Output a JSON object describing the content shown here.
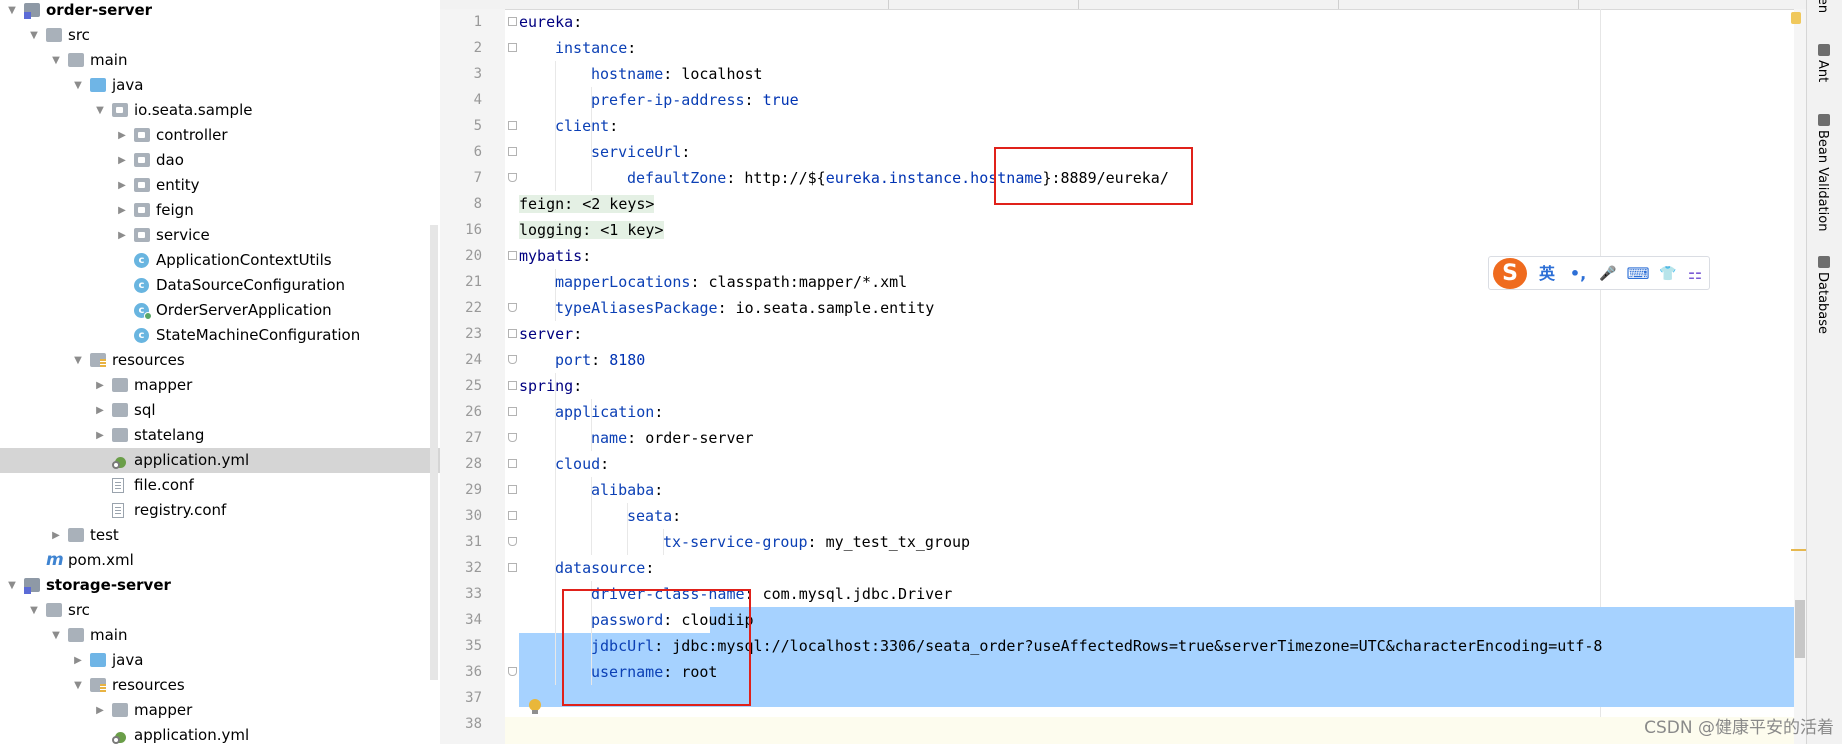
{
  "project_tree": {
    "items": [
      {
        "label": "order-server",
        "bold": true,
        "icon": "module-folder-icon",
        "expanded": true
      },
      {
        "label": "src",
        "icon": "folder-icon",
        "expanded": true
      },
      {
        "label": "main",
        "icon": "folder-icon",
        "expanded": true
      },
      {
        "label": "java",
        "icon": "source-root-folder-icon",
        "expanded": true
      },
      {
        "label": "io.seata.sample",
        "icon": "package-icon",
        "expanded": true
      },
      {
        "label": "controller",
        "icon": "package-icon",
        "expanded": false
      },
      {
        "label": "dao",
        "icon": "package-icon",
        "expanded": false
      },
      {
        "label": "entity",
        "icon": "package-icon",
        "expanded": false
      },
      {
        "label": "feign",
        "icon": "package-icon",
        "expanded": false
      },
      {
        "label": "service",
        "icon": "package-icon",
        "expanded": false
      },
      {
        "label": "ApplicationContextUtils",
        "icon": "java-class-icon"
      },
      {
        "label": "DataSourceConfiguration",
        "icon": "java-class-icon"
      },
      {
        "label": "OrderServerApplication",
        "icon": "spring-boot-class-icon"
      },
      {
        "label": "StateMachineConfiguration",
        "icon": "java-class-icon"
      },
      {
        "label": "resources",
        "icon": "resources-folder-icon",
        "expanded": true
      },
      {
        "label": "mapper",
        "icon": "folder-icon",
        "expanded": false
      },
      {
        "label": "sql",
        "icon": "folder-icon",
        "expanded": false
      },
      {
        "label": "statelang",
        "icon": "folder-icon",
        "expanded": false
      },
      {
        "label": "application.yml",
        "icon": "yaml-file-icon",
        "selected": true
      },
      {
        "label": "file.conf",
        "icon": "text-file-icon"
      },
      {
        "label": "registry.conf",
        "icon": "text-file-icon"
      },
      {
        "label": "test",
        "icon": "folder-icon",
        "expanded": false
      },
      {
        "label": "pom.xml",
        "icon": "maven-file-icon"
      },
      {
        "label": "storage-server",
        "bold": true,
        "icon": "module-folder-icon",
        "expanded": true
      },
      {
        "label": "src",
        "icon": "folder-icon",
        "expanded": true
      },
      {
        "label": "main",
        "icon": "folder-icon",
        "expanded": true
      },
      {
        "label": "java",
        "icon": "source-root-folder-icon",
        "expanded": false
      },
      {
        "label": "resources",
        "icon": "resources-folder-icon",
        "expanded": true
      },
      {
        "label": "mapper",
        "icon": "folder-icon",
        "expanded": false
      },
      {
        "label": "application.yml",
        "icon": "yaml-file-icon"
      }
    ]
  },
  "editor": {
    "lines": [
      {
        "n": "1",
        "key": "eureka",
        "val": ""
      },
      {
        "n": "2",
        "key": "instance",
        "val": ""
      },
      {
        "n": "3",
        "key": "hostname",
        "val": "localhost"
      },
      {
        "n": "4",
        "key": "prefer-ip-address",
        "val": "true"
      },
      {
        "n": "5",
        "key": "client",
        "val": ""
      },
      {
        "n": "6",
        "key": "serviceUrl",
        "val": ""
      },
      {
        "n": "7",
        "key": "defaultZone",
        "val_pre": "http://${",
        "val_ph": "eureka.instance.hostname",
        "val_post": "}:8889/eureka/"
      },
      {
        "n": "8",
        "folded": "feign: <2 keys>"
      },
      {
        "n": "16",
        "folded": "logging: <1 key>"
      },
      {
        "n": "20",
        "key": "mybatis",
        "val": ""
      },
      {
        "n": "21",
        "key": "mapperLocations",
        "val": "classpath:mapper/*.xml"
      },
      {
        "n": "22",
        "key": "typeAliasesPackage",
        "val": "io.seata.sample.entity"
      },
      {
        "n": "23",
        "key": "server",
        "val": ""
      },
      {
        "n": "24",
        "key": "port",
        "val": "8180"
      },
      {
        "n": "25",
        "key": "spring",
        "val": ""
      },
      {
        "n": "26",
        "key": "application",
        "val": ""
      },
      {
        "n": "27",
        "key": "name",
        "val": "order-server"
      },
      {
        "n": "28",
        "key": "cloud",
        "val": ""
      },
      {
        "n": "29",
        "key": "alibaba",
        "val": ""
      },
      {
        "n": "30",
        "key": "seata",
        "val": ""
      },
      {
        "n": "31",
        "key": "tx-service-group",
        "val": "my_test_tx_group"
      },
      {
        "n": "32",
        "key": "datasource",
        "val": ""
      },
      {
        "n": "33",
        "key": "driver-class-name",
        "val": "com.mysql.jdbc.Driver"
      },
      {
        "n": "34",
        "key": "password",
        "val": "cloudiip"
      },
      {
        "n": "35",
        "key": "jdbcUrl",
        "val": "jdbc:mysql://localhost:3306/seata_order?useAffectedRows=true&serverTimezone=UTC&characterEncoding=utf-8"
      },
      {
        "n": "36",
        "key": "username",
        "val": "root"
      },
      {
        "n": "37",
        "key": "",
        "val": ""
      },
      {
        "n": "38",
        "key": "",
        "val": ""
      }
    ]
  },
  "ime_toolbar": {
    "logo": "S",
    "items": [
      "英",
      "•,",
      "🎤",
      "⌨",
      "👕",
      "⚏"
    ]
  },
  "right_tool_strip": {
    "tabs": [
      "Maven",
      "Ant",
      "Bean Validation",
      "Database"
    ]
  },
  "watermark": "CSDN @健康平安的活着"
}
